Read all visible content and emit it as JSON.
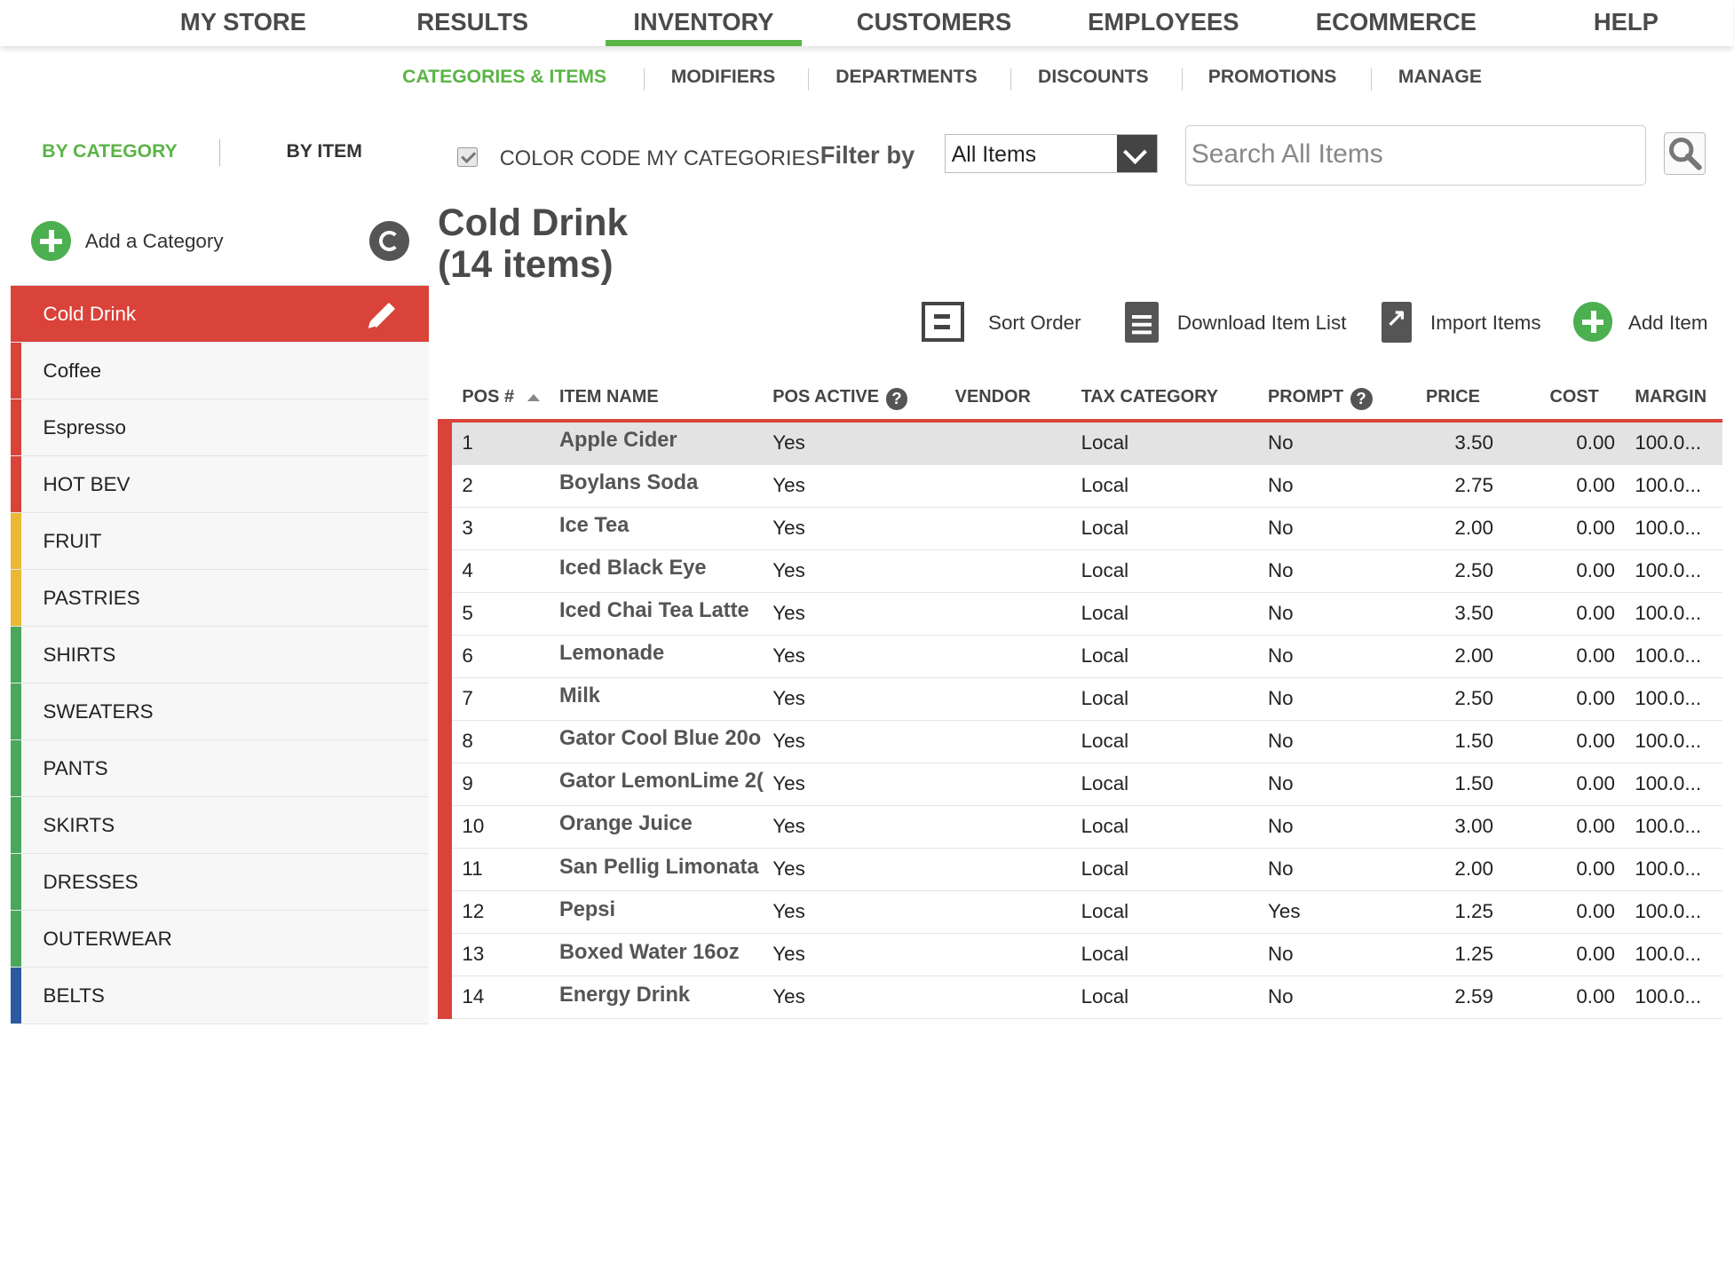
{
  "top_nav": [
    "MY STORE",
    "RESULTS",
    "INVENTORY",
    "CUSTOMERS",
    "EMPLOYEES",
    "ECOMMERCE",
    "HELP"
  ],
  "top_nav_active": "INVENTORY",
  "sub_nav": [
    "CATEGORIES & ITEMS",
    "MODIFIERS",
    "DEPARTMENTS",
    "DISCOUNTS",
    "PROMOTIONS",
    "MANAGE"
  ],
  "sub_nav_active": "CATEGORIES & ITEMS",
  "view_toggle": {
    "by_category": "BY CATEGORY",
    "by_item": "BY ITEM"
  },
  "color_code": {
    "label": "COLOR CODE MY CATEGORIES",
    "checked": true
  },
  "filter": {
    "label": "Filter by",
    "value": "All Items"
  },
  "search": {
    "placeholder": "Search All Items"
  },
  "sidebar": {
    "add_category": "Add a Category",
    "categories": [
      {
        "label": "Cold Drink",
        "color": "#d9433a",
        "active": true
      },
      {
        "label": "Coffee",
        "color": "#d9433a"
      },
      {
        "label": "Espresso",
        "color": "#d9433a"
      },
      {
        "label": "HOT BEV",
        "color": "#d9433a"
      },
      {
        "label": "FRUIT",
        "color": "#e9b935"
      },
      {
        "label": "PASTRIES",
        "color": "#e9b935"
      },
      {
        "label": "SHIRTS",
        "color": "#4aa85c"
      },
      {
        "label": "SWEATERS",
        "color": "#4aa85c"
      },
      {
        "label": "PANTS",
        "color": "#4aa85c"
      },
      {
        "label": "SKIRTS",
        "color": "#4aa85c"
      },
      {
        "label": "DRESSES",
        "color": "#4aa85c"
      },
      {
        "label": "OUTERWEAR",
        "color": "#4aa85c"
      },
      {
        "label": "BELTS",
        "color": "#2c5aa0"
      }
    ]
  },
  "main": {
    "title_line1": "Cold Drink",
    "title_line2": "(14 items)",
    "actions": {
      "sort": "Sort Order",
      "download": "Download Item List",
      "import": "Import Items",
      "add": "Add Item"
    }
  },
  "table": {
    "headers": [
      "POS #",
      "ITEM NAME",
      "POS ACTIVE",
      "VENDOR",
      "TAX CATEGORY",
      "PROMPT",
      "PRICE",
      "COST",
      "MARGIN"
    ],
    "rows": [
      [
        "1",
        "Apple Cider",
        "Yes",
        "",
        "Local",
        "No",
        "3.50",
        "0.00",
        "100.0..."
      ],
      [
        "2",
        "Boylans Soda",
        "Yes",
        "",
        "Local",
        "No",
        "2.75",
        "0.00",
        "100.0..."
      ],
      [
        "3",
        "Ice Tea",
        "Yes",
        "",
        "Local",
        "No",
        "2.00",
        "0.00",
        "100.0..."
      ],
      [
        "4",
        "Iced Black Eye",
        "Yes",
        "",
        "Local",
        "No",
        "2.50",
        "0.00",
        "100.0..."
      ],
      [
        "5",
        "Iced Chai Tea Latte",
        "Yes",
        "",
        "Local",
        "No",
        "3.50",
        "0.00",
        "100.0..."
      ],
      [
        "6",
        "Lemonade",
        "Yes",
        "",
        "Local",
        "No",
        "2.00",
        "0.00",
        "100.0..."
      ],
      [
        "7",
        "Milk",
        "Yes",
        "",
        "Local",
        "No",
        "2.50",
        "0.00",
        "100.0..."
      ],
      [
        "8",
        "Gator Cool Blue 20o",
        "Yes",
        "",
        "Local",
        "No",
        "1.50",
        "0.00",
        "100.0..."
      ],
      [
        "9",
        "Gator LemonLime 2(",
        "Yes",
        "",
        "Local",
        "No",
        "1.50",
        "0.00",
        "100.0..."
      ],
      [
        "10",
        "Orange Juice",
        "Yes",
        "",
        "Local",
        "No",
        "3.00",
        "0.00",
        "100.0..."
      ],
      [
        "11",
        "San Pellig Limonata",
        "Yes",
        "",
        "Local",
        "No",
        "2.00",
        "0.00",
        "100.0..."
      ],
      [
        "12",
        "Pepsi",
        "Yes",
        "",
        "Local",
        "Yes",
        "1.25",
        "0.00",
        "100.0..."
      ],
      [
        "13",
        "Boxed Water 16oz",
        "Yes",
        "",
        "Local",
        "No",
        "1.25",
        "0.00",
        "100.0..."
      ],
      [
        "14",
        "Energy Drink",
        "Yes",
        "",
        "Local",
        "No",
        "2.59",
        "0.00",
        "100.0..."
      ]
    ]
  },
  "colors": {
    "accent_green": "#5bb446",
    "accent_red": "#d9433a"
  }
}
